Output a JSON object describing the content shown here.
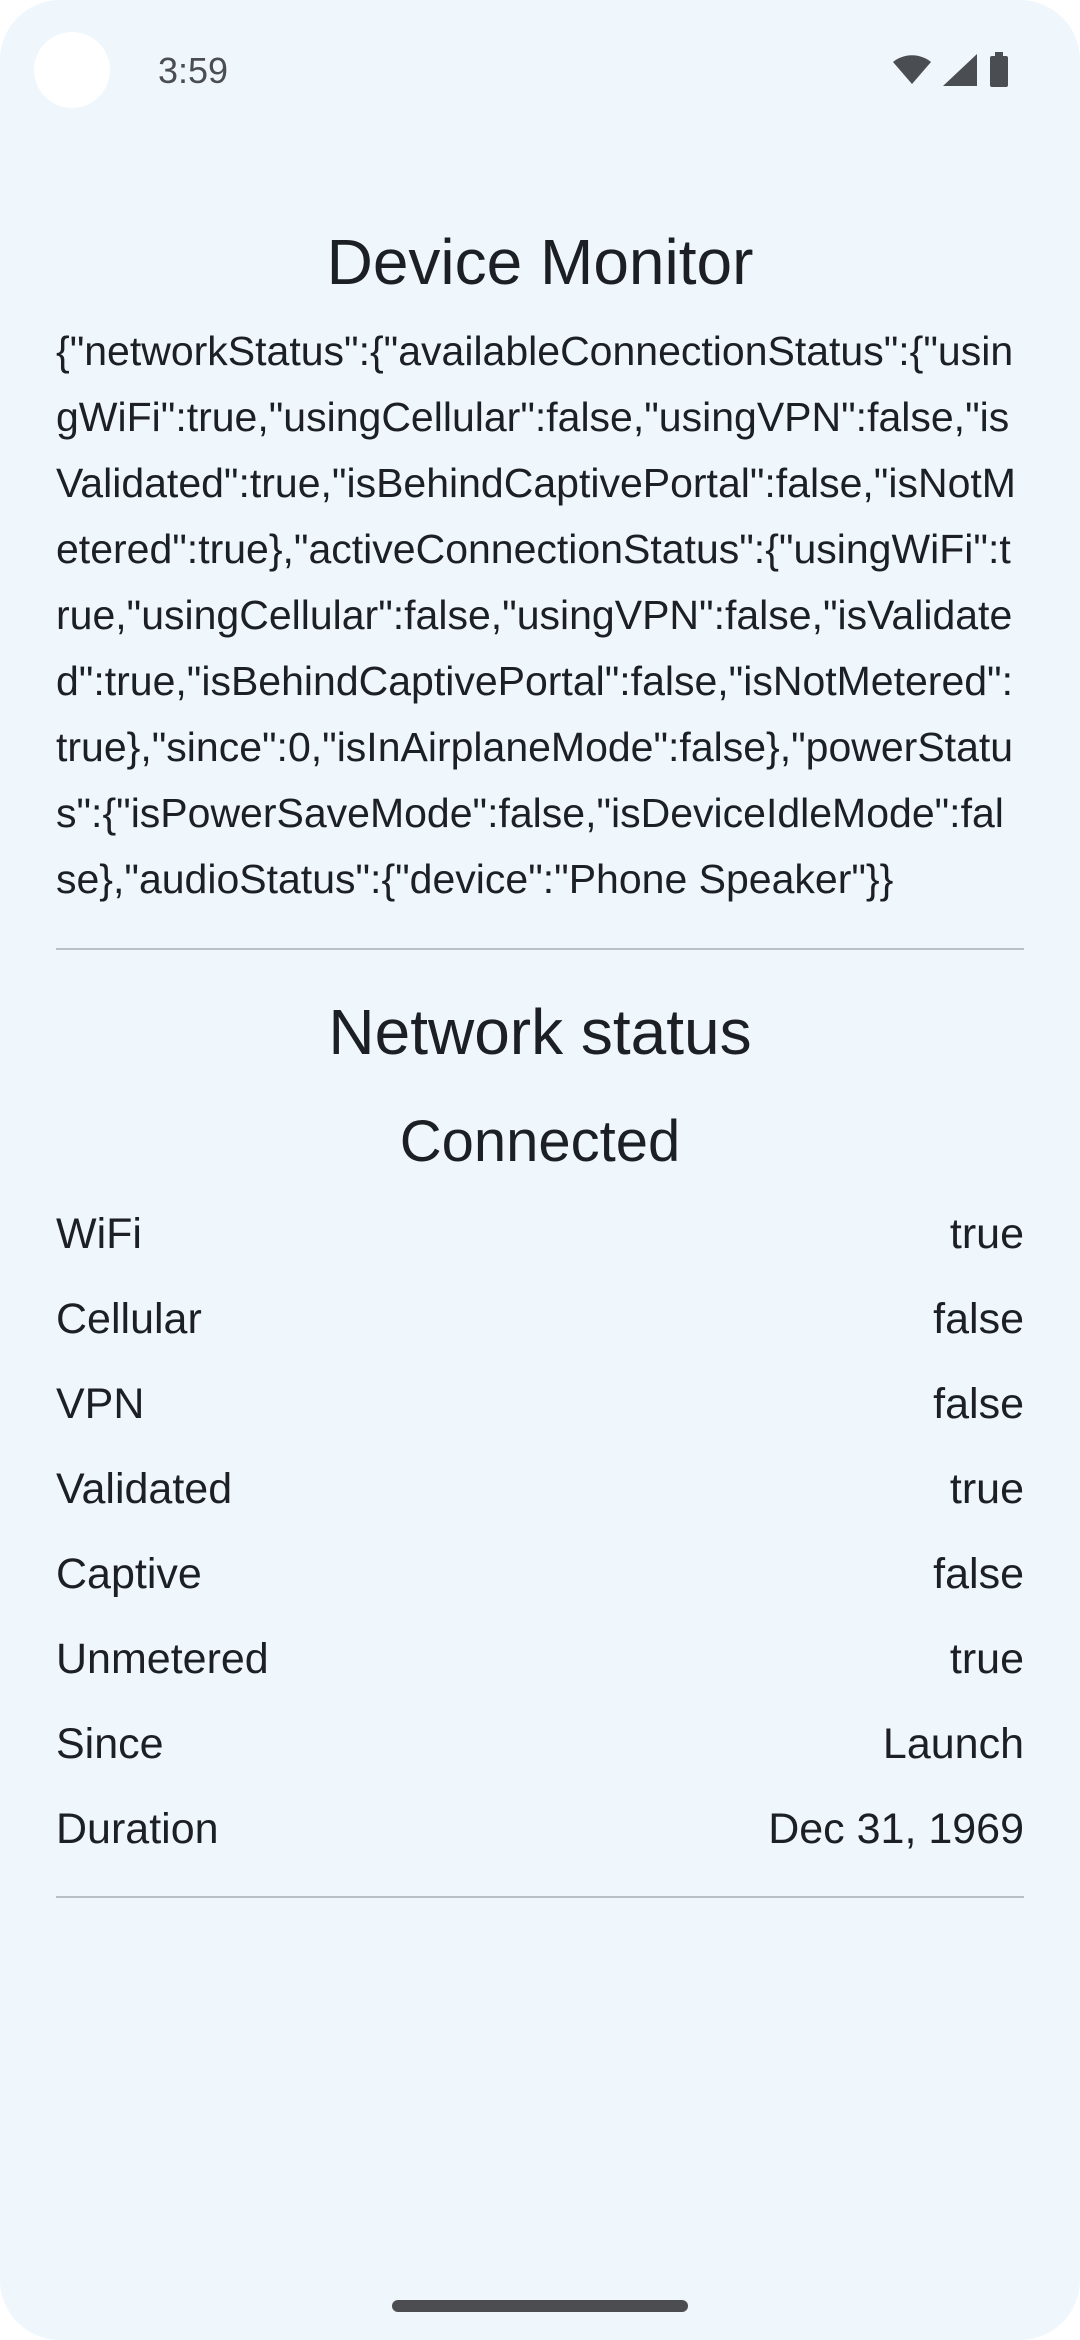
{
  "status_bar": {
    "time": "3:59",
    "icons": [
      "wifi-icon",
      "cellular-signal-icon",
      "battery-icon"
    ]
  },
  "app": {
    "title": "Device Monitor",
    "json_dump": "{\"networkStatus\":{\"availableConnectionStatus\":{\"usingWiFi\":true,\"usingCellular\":false,\"usingVPN\":false,\"isValidated\":true,\"isBehindCaptivePortal\":false,\"isNotMetered\":true},\"activeConnectionStatus\":{\"usingWiFi\":true,\"usingCellular\":false,\"usingVPN\":false,\"isValidated\":true,\"isBehindCaptivePortal\":false,\"isNotMetered\":true},\"since\":0,\"isInAirplaneMode\":false},\"powerStatus\":{\"isPowerSaveMode\":false,\"isDeviceIdleMode\":false},\"audioStatus\":{\"device\":\"Phone Speaker\"}}"
  },
  "network": {
    "section_title": "Network status",
    "state": "Connected",
    "rows": [
      {
        "label": "WiFi",
        "value": "true"
      },
      {
        "label": "Cellular",
        "value": "false"
      },
      {
        "label": "VPN",
        "value": "false"
      },
      {
        "label": "Validated",
        "value": "true"
      },
      {
        "label": "Captive",
        "value": "false"
      },
      {
        "label": "Unmetered",
        "value": "true"
      },
      {
        "label": "Since",
        "value": "Launch"
      },
      {
        "label": "Duration",
        "value": "Dec 31, 1969"
      }
    ]
  },
  "colors": {
    "background": "#eff6fc",
    "text": "#1c1f23",
    "divider": "#b9c0c6"
  }
}
